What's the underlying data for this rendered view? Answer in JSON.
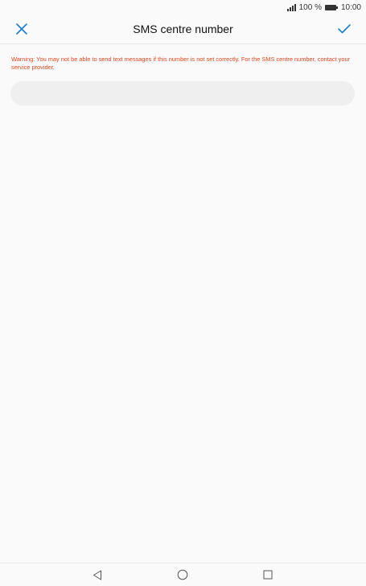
{
  "status_bar": {
    "battery_percent": "100 %",
    "time": "10:00",
    "icons": [
      "signal-icon",
      "battery-icon"
    ]
  },
  "app_bar": {
    "title": "SMS centre number",
    "close_icon": "close-icon",
    "confirm_icon": "checkmark-icon"
  },
  "warning": {
    "text": "Warning: You may not be able to send text messages if this number is not set correctly. For the SMS centre number, contact your service provider."
  },
  "input": {
    "value": "",
    "placeholder": ""
  },
  "nav_bar": {
    "icons": [
      "back-icon",
      "home-icon",
      "recents-icon"
    ]
  },
  "colors": {
    "accent": "#1a7fd4",
    "warning": "#e0451f",
    "background": "#fafafa",
    "input_background": "#efefef"
  }
}
